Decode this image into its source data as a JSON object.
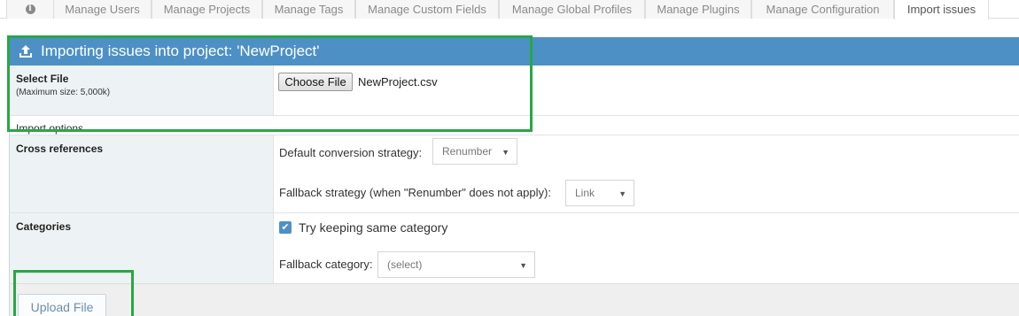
{
  "tabs": [
    {
      "label": "",
      "icon": "info-icon"
    },
    {
      "label": "Manage Users"
    },
    {
      "label": "Manage Projects"
    },
    {
      "label": "Manage Tags"
    },
    {
      "label": "Manage Custom Fields"
    },
    {
      "label": "Manage Global Profiles"
    },
    {
      "label": "Manage Plugins"
    },
    {
      "label": "Manage Configuration"
    },
    {
      "label": "Import issues",
      "active": true
    }
  ],
  "header": {
    "title": "Importing issues into project: 'NewProject'",
    "icon": "upload-icon"
  },
  "select_file": {
    "label": "Select File",
    "sublabel": "(Maximum size: 5,000k)",
    "button_label": "Choose File",
    "file_name": "NewProject.csv"
  },
  "import_options": {
    "label": "Import options"
  },
  "cross_references": {
    "label": "Cross references",
    "default_strategy_label": "Default conversion strategy:",
    "default_strategy_value": "Renumber",
    "fallback_strategy_label": "Fallback strategy (when \"Renumber\" does not apply):",
    "fallback_strategy_value": "Link"
  },
  "categories": {
    "label": "Categories",
    "keep_same_label": "Try keeping same category",
    "keep_same_checked": true,
    "fallback_label": "Fallback category:",
    "fallback_value": "(select)"
  },
  "footer": {
    "upload_button_label": "Upload File"
  },
  "colors": {
    "header": "#4d90c5",
    "highlight": "#27a844"
  }
}
